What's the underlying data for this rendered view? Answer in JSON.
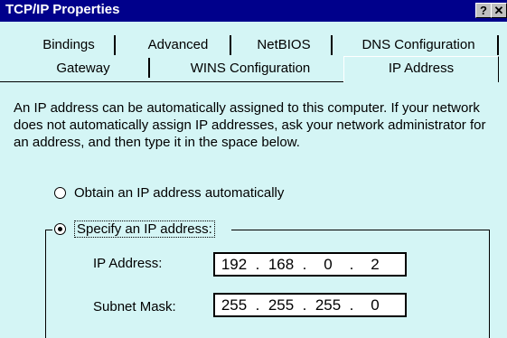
{
  "window": {
    "title": "TCP/IP Properties",
    "help_label": "?",
    "close_label": "✕"
  },
  "tabs": {
    "row1": [
      "Bindings",
      "Advanced",
      "NetBIOS",
      "DNS Configuration"
    ],
    "row2": [
      "Gateway",
      "WINS Configuration",
      "IP Address"
    ],
    "active": "IP Address"
  },
  "ip_address_tab": {
    "description": "An IP address can be automatically assigned to this computer.  If your network does not automatically assign IP addresses, ask your network administrator for an address, and then type it in the space below.",
    "obtain_auto_label": "Obtain an IP address automatically",
    "obtain_auto_checked": false,
    "specify_label": "Specify an IP address:",
    "specify_checked": true,
    "ip_address_label": "IP Address:",
    "ip_address": [
      "192",
      "168",
      "0",
      "2"
    ],
    "subnet_mask_label": "Subnet Mask:",
    "subnet_mask": [
      "255",
      "255",
      "255",
      "0"
    ]
  }
}
